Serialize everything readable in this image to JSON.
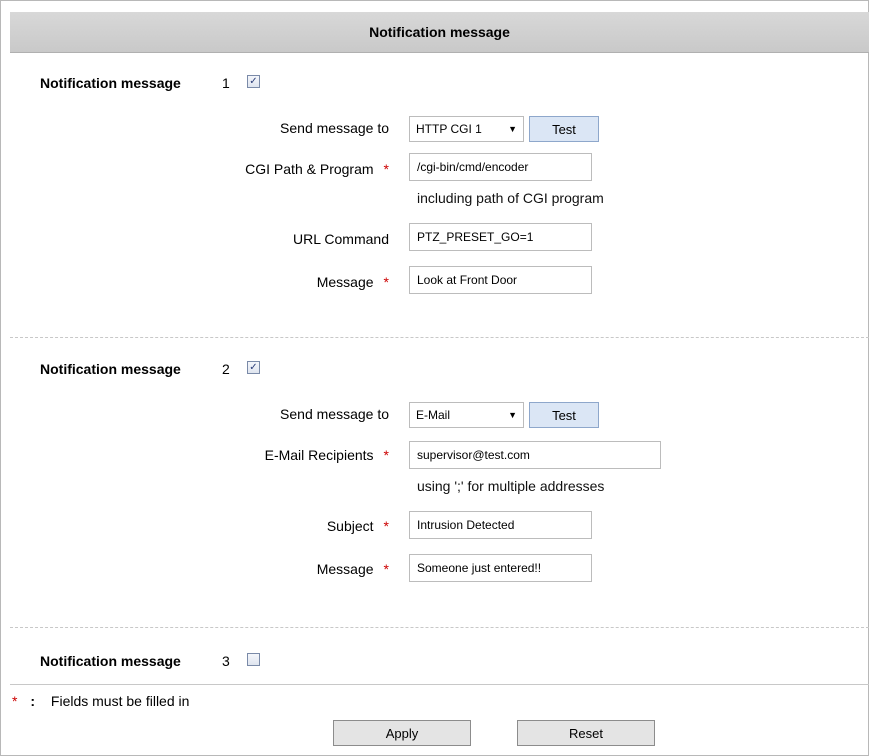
{
  "header": {
    "title": "Notification message"
  },
  "sections": [
    {
      "title": "Notification message",
      "number": "1",
      "checked": true,
      "send_to_label": "Send message to",
      "send_to_value": "HTTP CGI 1",
      "test_label": "Test",
      "field1_label": "CGI Path & Program",
      "field1_value": "/cgi-bin/cmd/encoder",
      "field1_hint": "including path of CGI program",
      "field2_label": "URL Command",
      "field2_value": "PTZ_PRESET_GO=1",
      "message_label": "Message",
      "message_value": "Look at Front Door"
    },
    {
      "title": "Notification message",
      "number": "2",
      "checked": true,
      "send_to_label": "Send message to",
      "send_to_value": "E-Mail",
      "test_label": "Test",
      "recipients_label": "E-Mail Recipients",
      "recipients_value": "supervisor@test.com",
      "recipients_hint": "using ';' for multiple addresses",
      "subject_label": "Subject",
      "subject_value": "Intrusion Detected",
      "message_label": "Message",
      "message_value": "Someone just entered!!"
    },
    {
      "title": "Notification message",
      "number": "3",
      "checked": false
    }
  ],
  "footer": {
    "required_star": "*",
    "required_colon": ":",
    "required_text": "Fields must be filled in",
    "apply_label": "Apply",
    "reset_label": "Reset"
  },
  "icons": {
    "checkbox_checked": "check-icon",
    "select_arrow": "chevron-down-icon"
  },
  "colors": {
    "required": "#cc0000",
    "test_button": "#dbe6f5",
    "header_bg": "#d0d0d0"
  }
}
